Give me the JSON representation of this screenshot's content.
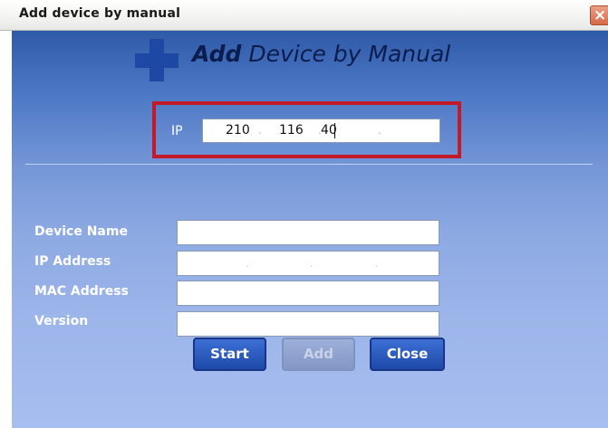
{
  "window": {
    "title": "Add device by manual",
    "close_glyph": "×"
  },
  "header": {
    "title_bold": "Add",
    "title_rest": " Device by Manual",
    "icon": "plus-icon"
  },
  "ip_search": {
    "label": "IP",
    "octets": [
      "210",
      "116",
      "40",
      ""
    ],
    "separator": "."
  },
  "form": {
    "device_name_label": "Device Name",
    "ip_address_label": "IP Address",
    "mac_address_label": "MAC Address",
    "version_label": "Version",
    "ip_separator": "."
  },
  "buttons": {
    "start": "Start",
    "add": "Add",
    "close": "Close"
  },
  "colors": {
    "highlight_border": "#c21a28",
    "button_blue": "#1d4aa8",
    "panel_top": "#2f5aa8",
    "panel_bottom": "#a7bef0"
  }
}
